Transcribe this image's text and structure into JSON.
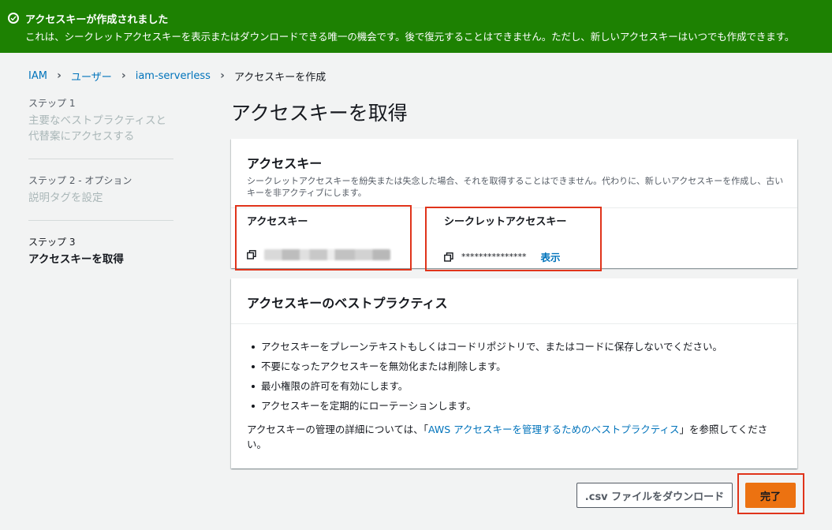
{
  "flash": {
    "title": "アクセスキーが作成されました",
    "message": "これは、シークレットアクセスキーを表示またはダウンロードできる唯一の機会です。後で復元することはできません。ただし、新しいアクセスキーはいつでも作成できます。",
    "color": "#1d8102"
  },
  "breadcrumb": {
    "items": [
      "IAM",
      "ユーザー",
      "iam-serverless",
      "アクセスキーを作成"
    ]
  },
  "steps": [
    {
      "num": "ステップ 1",
      "name": "主要なベストプラクティスと代替案にアクセスする"
    },
    {
      "num": "ステップ 2 - オプション",
      "name": "説明タグを設定"
    },
    {
      "num": "ステップ 3",
      "name": "アクセスキーを取得"
    }
  ],
  "page_title": "アクセスキーを取得",
  "access_key_panel": {
    "title": "アクセスキー",
    "description": "シークレットアクセスキーを紛失または失念した場合、それを取得することはできません。代わりに、新しいアクセスキーを作成し、古いキーを非アクティブにします。",
    "access_key_label": "アクセスキー",
    "secret_key_label": "シークレットアクセスキー",
    "secret_key_masked": "***************",
    "show_label": "表示"
  },
  "best_practices": {
    "title": "アクセスキーのベストプラクティス",
    "items": [
      "アクセスキーをプレーンテキストもしくはコードリポジトリで、またはコードに保存しないでください。",
      "不要になったアクセスキーを無効化または削除します。",
      "最小権限の許可を有効にします。",
      "アクセスキーを定期的にローテーションします。"
    ],
    "note_prefix": "アクセスキーの管理の詳細については、「",
    "note_link": "AWS アクセスキーを管理するためのベストプラクティス",
    "note_suffix": "」を参照してください。"
  },
  "buttons": {
    "csv_label": ".csv ファイルをダウンロード",
    "done_label": "完了"
  },
  "colors": {
    "accent": "#ec7211",
    "link": "#0073bb",
    "highlight_box": "#e0341b"
  }
}
